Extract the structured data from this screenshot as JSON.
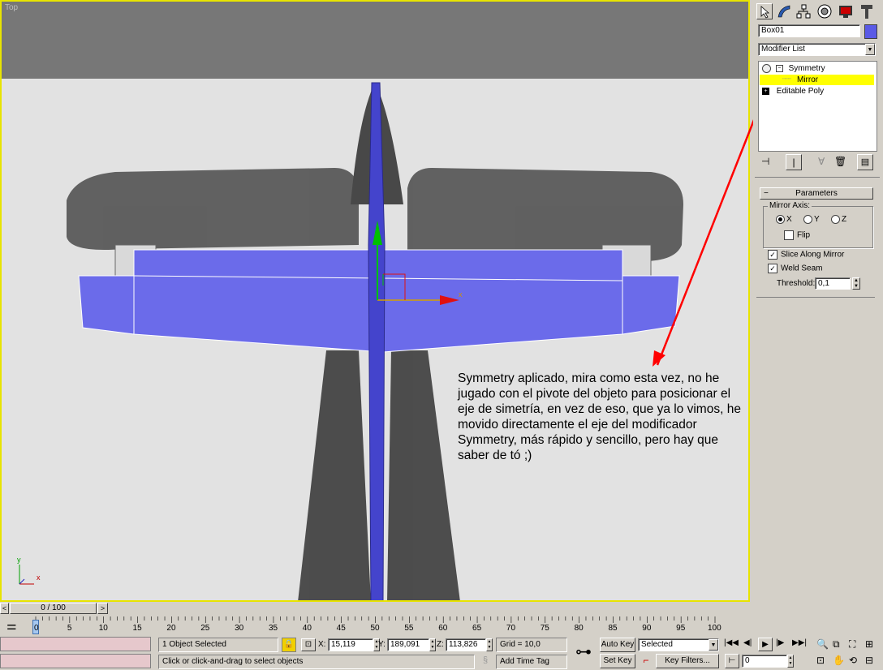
{
  "viewport": {
    "label": "Top",
    "annotation": "Symmetry aplicado, mira como esta vez, no he jugado con el pivote del objeto para posicionar el eje de simetría, en vez de eso, que ya lo vimos, he movido directamente el eje del modificador Symmetry, más rápido y sencillo, pero hay que saber de tó ;)",
    "gizmo_x_label": "x",
    "axis_x_label": "x",
    "axis_y_label": "y"
  },
  "panel": {
    "toolbar_icons": [
      "create-icon",
      "modify-icon",
      "hierarchy-icon",
      "motion-icon",
      "display-icon",
      "utilities-icon"
    ],
    "object_name": "Box01",
    "object_color": "#5a5ae6",
    "modifier_list": "Modifier List",
    "stack": {
      "symmetry": "Symmetry",
      "mirror": "Mirror",
      "editable_poly": "Editable Poly"
    },
    "rollout_title": "Parameters",
    "mirror_axis_label": "Mirror Axis:",
    "axis_x": "X",
    "axis_y": "Y",
    "axis_z": "Z",
    "selected_axis": "X",
    "flip_label": "Flip",
    "flip_checked": false,
    "slice_label": "Slice Along Mirror",
    "slice_checked": true,
    "weld_label": "Weld Seam",
    "weld_checked": true,
    "threshold_label": "Threshold:",
    "threshold_value": "0,1"
  },
  "timeline": {
    "frame_counter": "0 / 100",
    "current_frame": "0",
    "ticks": [
      "5",
      "10",
      "15",
      "20",
      "25",
      "30",
      "35",
      "40",
      "45",
      "50",
      "55",
      "60",
      "65",
      "70",
      "75",
      "80",
      "85",
      "90",
      "95",
      "100"
    ]
  },
  "status": {
    "selection": "1 Object Selected",
    "prompt": "Click or click-and-drag to select objects",
    "x_label": "X:",
    "x_value": "15,119",
    "y_label": "Y:",
    "y_value": "189,091",
    "z_label": "Z:",
    "z_value": "113,826",
    "grid": "Grid = 10,0",
    "add_time_tag": "Add Time Tag",
    "auto_key": "Auto Key",
    "set_key": "Set Key",
    "key_mode": "Selected",
    "key_filters": "Key Filters...",
    "frame_value": "0"
  },
  "colors": {
    "viewport_border": "#e8e400",
    "model": "#6b6bea",
    "selection_highlight": "#ffff00",
    "annotation_arrow": "#ff0000"
  }
}
